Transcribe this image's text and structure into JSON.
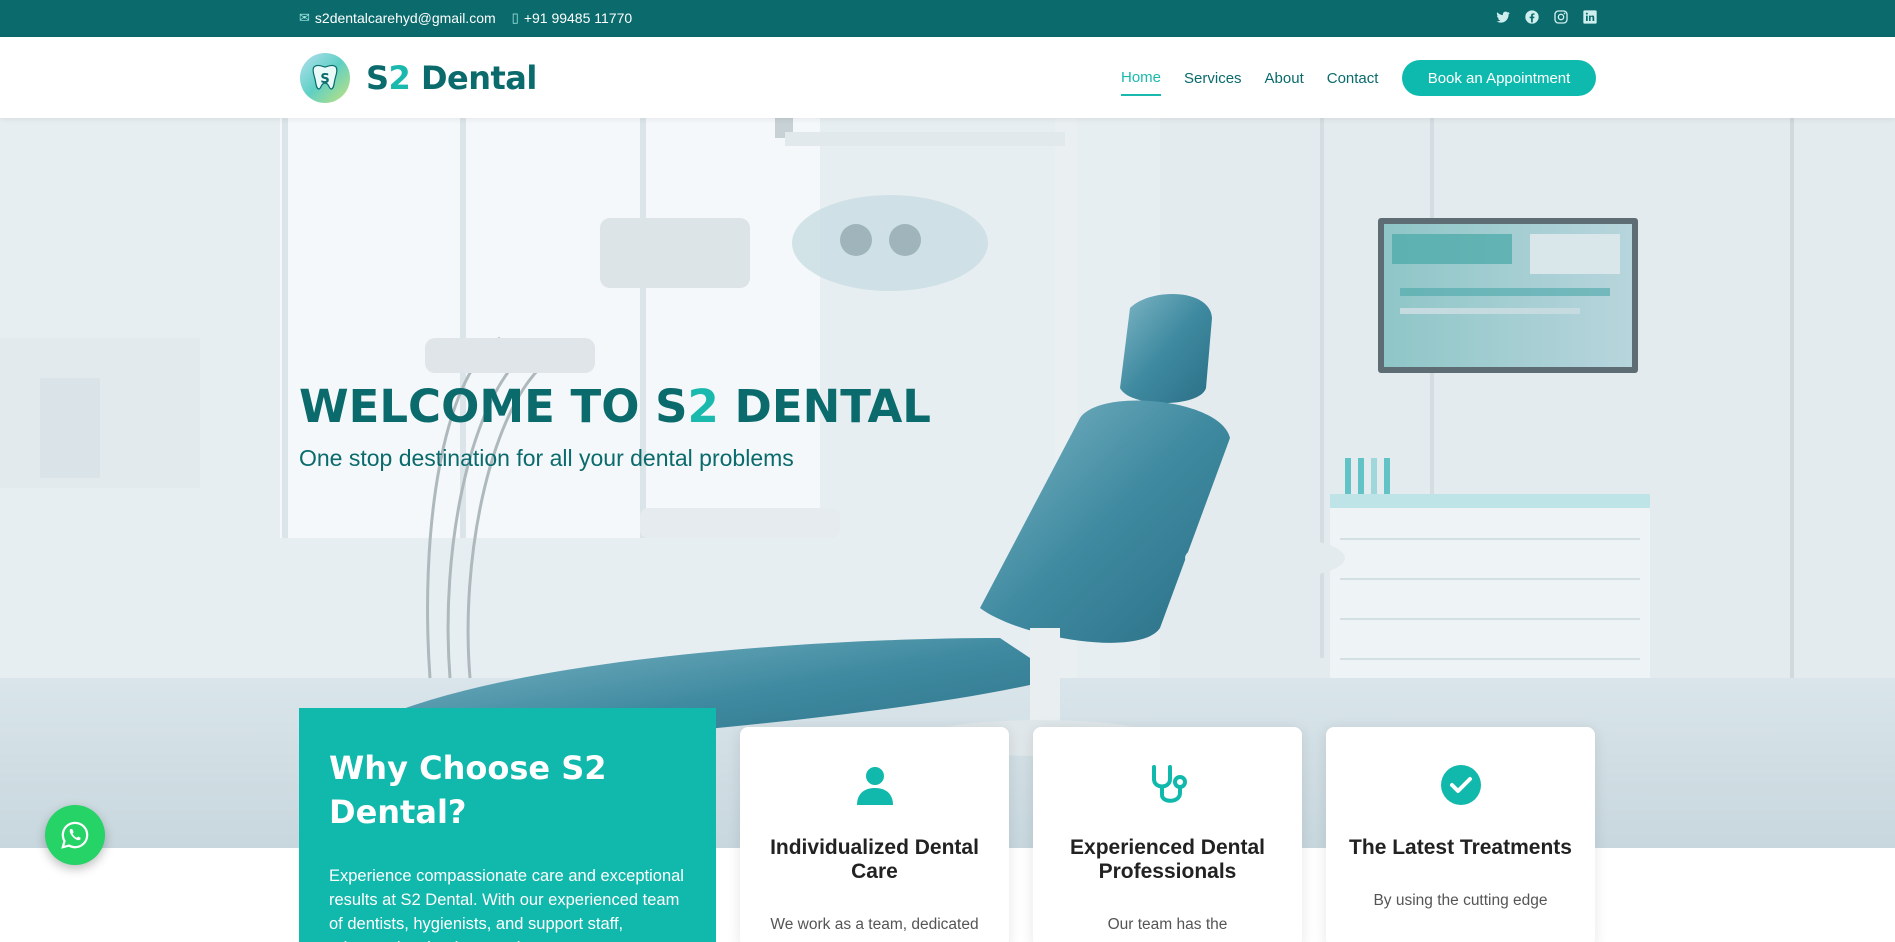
{
  "topbar": {
    "email": "s2dentalcarehyd@gmail.com",
    "phone": "+91 99485 11770",
    "socials": [
      "twitter-icon",
      "facebook-icon",
      "instagram-icon",
      "linkedin-icon"
    ]
  },
  "header": {
    "brand_prefix": "S",
    "brand_number": "2",
    "brand_suffix": " Dental",
    "nav": [
      "Home",
      "Services",
      "About",
      "Contact"
    ],
    "active_nav": "Home",
    "cta": "Book an Appointment"
  },
  "hero": {
    "title_prefix": "WELCOME TO S",
    "title_number": "2",
    "title_suffix": " DENTAL",
    "subtitle": "One stop destination for all your dental problems"
  },
  "why": {
    "title": "Why Choose S2 Dental?",
    "text": "Experience compassionate care and exceptional results at S2 Dental. With our experienced team of dentists, hygienists, and support staff, advanced technology, and"
  },
  "features": [
    {
      "icon": "user-icon",
      "title": "Individualized Dental Care",
      "text": "We work as a team, dedicated"
    },
    {
      "icon": "stethoscope-icon",
      "title": "Experienced Dental Professionals",
      "text": "Our team has the"
    },
    {
      "icon": "check-circle-icon",
      "title": "The Latest Treatments",
      "text": "By using the cutting edge"
    }
  ],
  "colors": {
    "primary": "#0a6a6c",
    "accent": "#1ab9ad",
    "whatsapp": "#25d366"
  },
  "floating": {
    "icon": "whatsapp-icon"
  }
}
